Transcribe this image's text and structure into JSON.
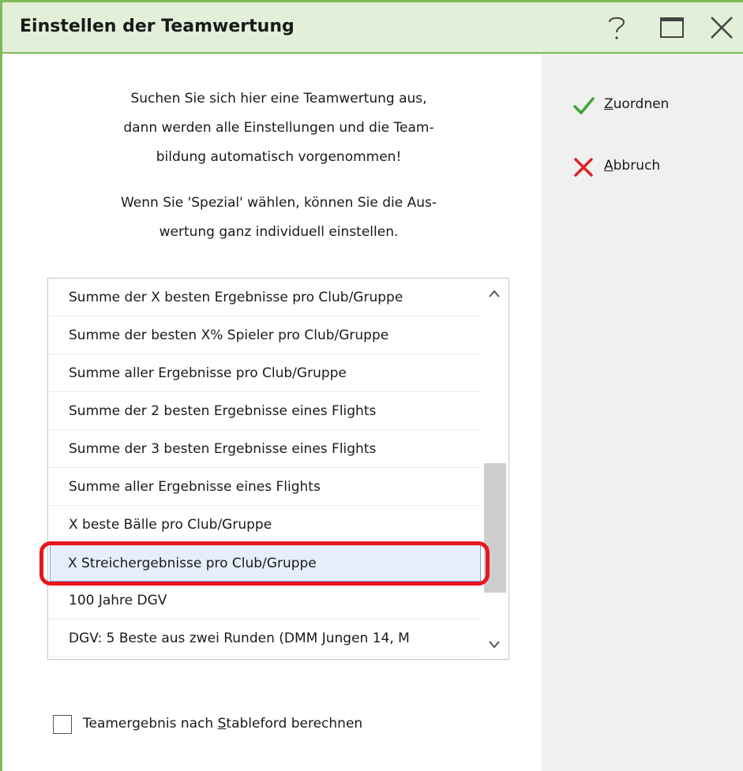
{
  "window": {
    "title": "Einstellen der Teamwertung",
    "accent_color": "#7fba5a",
    "titlebar_color": "#e2efd9",
    "buttons": [
      "help-icon",
      "maximize-icon",
      "close-icon"
    ]
  },
  "intro": {
    "paragraph1": [
      "Suchen Sie sich hier eine Teamwertung aus,",
      "dann werden alle Einstellungen und die Team-",
      "bildung automatisch vorgenommen!"
    ],
    "paragraph2": [
      "Wenn Sie 'Spezial' wählen, können Sie die Aus-",
      "wertung ganz individuell einstellen."
    ]
  },
  "list": {
    "items": [
      "Summe der X besten Ergebnisse pro Club/Gruppe",
      "Summe der besten X% Spieler pro Club/Gruppe",
      "Summe aller Ergebnisse pro Club/Gruppe",
      "Summe der 2 besten Ergebnisse eines Flights",
      "Summe der 3 besten Ergebnisse eines Flights",
      "Summe aller Ergebnisse eines Flights",
      "X beste Bälle pro Club/Gruppe",
      "X Streichergebnisse pro Club/Gruppe",
      "100 Jahre DGV",
      "DGV: 5 Beste aus zwei Runden (DMM Jungen 14, M"
    ],
    "selected_index": 7,
    "highlight_color": "#e8171f"
  },
  "checkbox": {
    "label_before": "Teamergebnis nach ",
    "label_accel": "S",
    "label_after": "tableford berechnen",
    "checked": false
  },
  "actions": {
    "assign": {
      "accel": "Z",
      "rest": "uordnen",
      "icon": "checkmark-icon",
      "color": "#3aa63a"
    },
    "cancel": {
      "accel": "A",
      "rest": "bbruch",
      "icon": "cross-icon",
      "color": "#e0222a"
    }
  }
}
